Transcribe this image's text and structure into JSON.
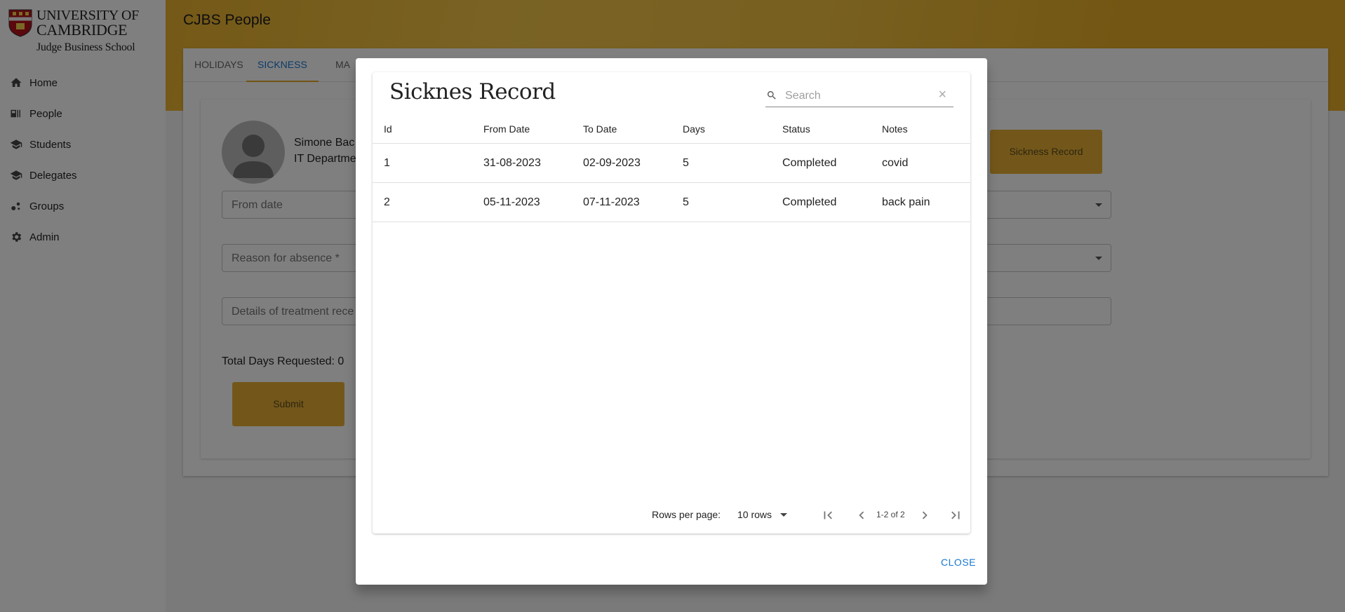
{
  "brand": {
    "line1": "UNIVERSITY OF",
    "line2": "CAMBRIDGE",
    "line3": "Judge Business School"
  },
  "sidebar": {
    "items": [
      {
        "label": "Home",
        "icon": "home-icon"
      },
      {
        "label": "People",
        "icon": "people-icon"
      },
      {
        "label": "Students",
        "icon": "students-icon"
      },
      {
        "label": "Delegates",
        "icon": "delegates-icon"
      },
      {
        "label": "Groups",
        "icon": "groups-icon"
      },
      {
        "label": "Admin",
        "icon": "gear-icon"
      }
    ]
  },
  "header": {
    "title": "CJBS People"
  },
  "tabs": [
    {
      "label": "HOLIDAYS",
      "active": false
    },
    {
      "label": "SICKNESS",
      "active": true
    },
    {
      "label": "MA",
      "active": false
    }
  ],
  "form": {
    "person_name": "Simone Bac",
    "person_dept": "IT Departme",
    "sickness_record_button": "Sickness Record",
    "from_date_placeholder": "From date",
    "reason_placeholder": "Reason for absence *",
    "details_placeholder": "Details of treatment rece",
    "total_days": "Total Days Requested: 0",
    "submit_label": "Submit"
  },
  "dialog": {
    "title": "Sicknes Record",
    "search_placeholder": "Search",
    "columns": [
      "Id",
      "From Date",
      "To Date",
      "Days",
      "Status",
      "Notes"
    ],
    "rows": [
      [
        "1",
        "31-08-2023",
        "02-09-2023",
        "5",
        "Completed",
        "covid"
      ],
      [
        "2",
        "05-11-2023",
        "07-11-2023",
        "5",
        "Completed",
        "back pain"
      ]
    ],
    "rows_per_page_label": "Rows per page:",
    "rows_per_page_value": "10 rows",
    "page_range": "1-2 of 2",
    "close_label": "CLOSE"
  },
  "colors": {
    "accent": "#e7ae34",
    "link": "#1976d2",
    "overlay": "rgba(0,0,0,0.5)"
  }
}
